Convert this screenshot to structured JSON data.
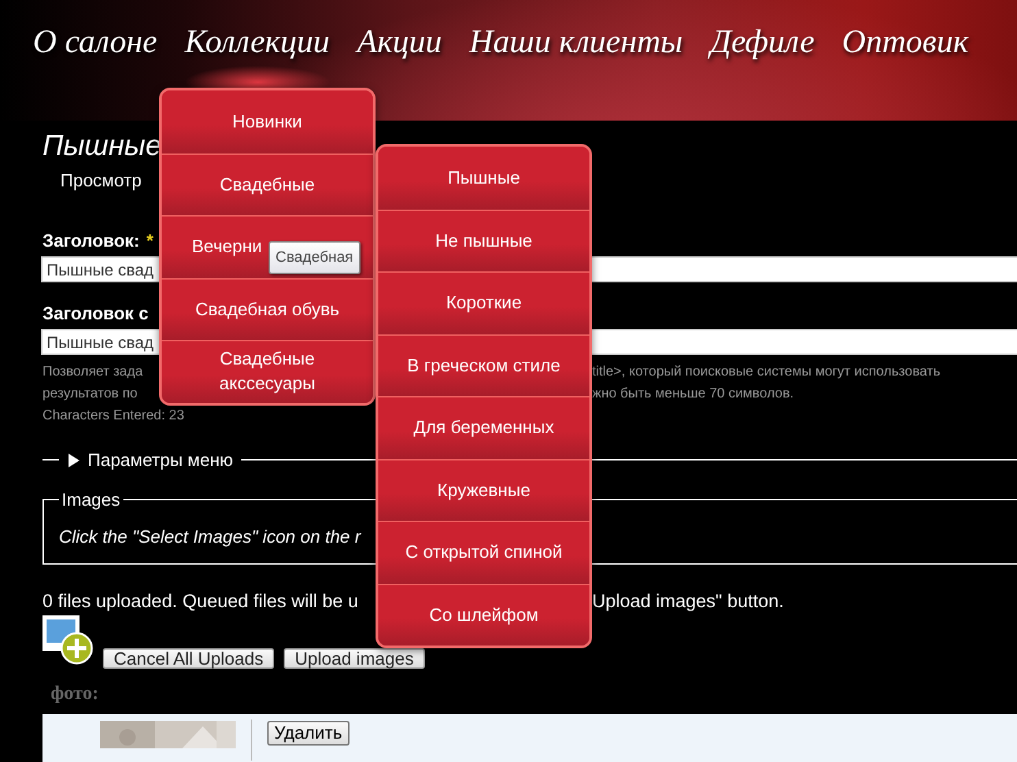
{
  "nav": {
    "items": [
      {
        "label": "О салоне",
        "selected": false
      },
      {
        "label": "Коллекции",
        "selected": true
      },
      {
        "label": "Акции",
        "selected": false
      },
      {
        "label": "Наши клиенты",
        "selected": false
      },
      {
        "label": "Дефиле",
        "selected": false
      },
      {
        "label": "Оптовик",
        "selected": false
      }
    ]
  },
  "menu": {
    "items": [
      {
        "label": "Новинки",
        "hovered": false
      },
      {
        "label": "Свадебные",
        "hovered": false
      },
      {
        "label": "Вечерни",
        "hovered": true
      },
      {
        "label": "Свадебная обувь",
        "hovered": false
      },
      {
        "label": "Свадебные акссесуары",
        "hovered": false
      }
    ]
  },
  "submenu": {
    "items": [
      {
        "label": "Пышные"
      },
      {
        "label": "Не пышные"
      },
      {
        "label": "Короткие"
      },
      {
        "label": "В греческом стиле"
      },
      {
        "label": "Для беременных"
      },
      {
        "label": "Кружевные"
      },
      {
        "label": "С открытой спиной"
      },
      {
        "label": "Со шлейфом"
      }
    ]
  },
  "tooltip": "Свадебная",
  "page": {
    "title": "Пышные",
    "tab": "Просмотр",
    "fields": [
      {
        "label": "Заголовок:",
        "marker": "*",
        "value": "Пышные свад"
      },
      {
        "label": "Заголовок с",
        "value": "Пышные свад"
      }
    ],
    "help": [
      {
        "left": "Позволяет зада",
        "right": "title>, который поисковые системы могут использовать"
      },
      {
        "left": "результатов по",
        "right": "жно быть меньше 70 символов."
      }
    ],
    "characters": "Characters Entered: 23",
    "menu_params": "Параметры меню",
    "images": {
      "legend": "Images",
      "hint": "Click the \"Select Images\" icon on the r"
    },
    "upload_status": {
      "left": "0 files uploaded. Queued files will be u",
      "right": "Upload images\" button."
    },
    "buttons": [
      "Cancel All Uploads",
      "Upload images"
    ],
    "photo_label": "фото:",
    "delete_button": "Удалить"
  }
}
